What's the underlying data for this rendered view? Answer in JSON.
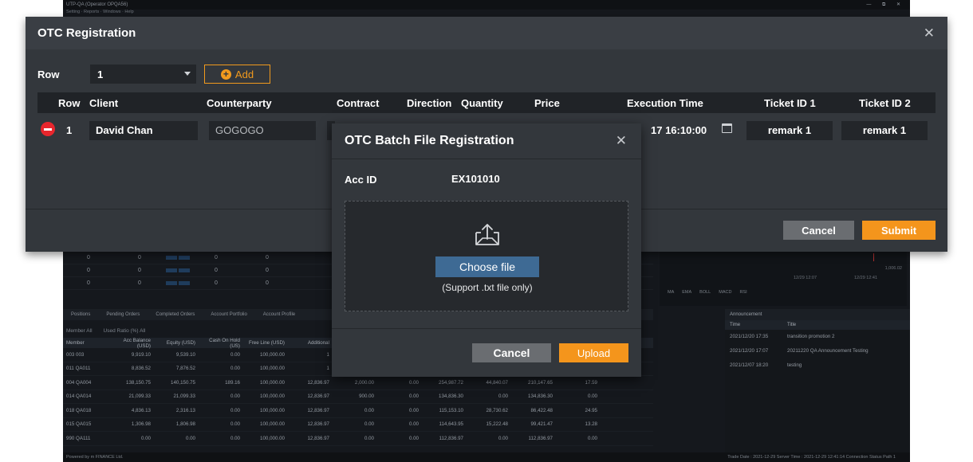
{
  "background": {
    "title": "UTP-QA (Operator OPQA56)",
    "menu": "Setting · Reports · Windows · Help",
    "window_controls": "— ⧉ ✕",
    "tabs": [
      "Positions",
      "Pending Orders",
      "Completed Orders",
      "Account Portfolio",
      "Account Profile"
    ],
    "filter": {
      "member_label": "Member",
      "member_value": "All",
      "ratio_label": "Used Ratio (%)",
      "ratio_value": "All"
    },
    "columns": [
      "Member",
      "Acc Balance (USD)",
      "Equity (USD)",
      "Cash On Hold (US)",
      "Free Line (USD)",
      "Additional"
    ],
    "rows": [
      [
        "003 003",
        "9,919.10",
        "9,539.10",
        "0.00",
        "100,000.00",
        "1"
      ],
      [
        "011 QA011",
        "8,836.52",
        "7,876.52",
        "0.00",
        "100,000.00",
        "1"
      ],
      [
        "004 QA004",
        "138,150.75",
        "140,150.75",
        "189.16",
        "100,000.00",
        "12,836.97",
        "2,000.00",
        "0.00",
        "254,987.72",
        "44,840.07",
        "210,147.65",
        "17.59"
      ],
      [
        "014 QA014",
        "21,099.33",
        "21,099.33",
        "0.00",
        "100,000.00",
        "12,836.97",
        "900.00",
        "0.00",
        "134,836.30",
        "0.00",
        "134,836.30",
        "0.00"
      ],
      [
        "018 QA018",
        "4,836.13",
        "2,316.13",
        "0.00",
        "100,000.00",
        "12,836.97",
        "0.00",
        "0.00",
        "115,153.10",
        "28,730.62",
        "86,422.48",
        "24.95"
      ],
      [
        "015 QA015",
        "1,306.98",
        "1,806.98",
        "0.00",
        "100,000.00",
        "12,836.97",
        "0.00",
        "0.00",
        "114,643.95",
        "15,222.48",
        "99,421.47",
        "13.28"
      ],
      [
        "990 QA111",
        "0.00",
        "0.00",
        "0.00",
        "100,000.00",
        "12,836.97",
        "0.00",
        "0.00",
        "112,836.97",
        "0.00",
        "112,836.97",
        "0.00"
      ]
    ],
    "chart_labels": [
      "1,006.02",
      "12/29 12:07",
      "12/29 12:41"
    ],
    "chart_tabs": [
      "MA",
      "EMA",
      "BOLL",
      "MACD",
      "RSI"
    ],
    "announcement": {
      "tab": "Announcement",
      "columns": [
        "Time",
        "Title"
      ],
      "rows": [
        [
          "2021/12/20 17:35",
          "transition promotion 2"
        ],
        [
          "2021/12/20 17:07",
          "20211220 QA Announcement Testing"
        ],
        [
          "2021/12/07 18:20",
          "testing"
        ]
      ]
    },
    "status_left": "Powered by m FINANCE Ltd.",
    "status_right": "Trade Date : 2021-12-29   Server Time : 2021-12-29 12:41:14   Connection Status   Path 1"
  },
  "otc": {
    "title": "OTC Registration",
    "close_glyph": "✕",
    "row_label": "Row",
    "row_value": "1",
    "add_label": "Add",
    "add_glyph": "+",
    "columns": [
      "Row",
      "Client",
      "Counterparty",
      "Contract",
      "Direction",
      "Quantity",
      "Price",
      "Execution Time",
      "Ticket ID 1",
      "Ticket ID 2"
    ],
    "row": {
      "num": "1",
      "client": "David Chan",
      "counterparty": "GOGOGO",
      "execution_time": "17 16:10:00",
      "ticket1": "remark 1",
      "ticket2": "remark 1"
    },
    "cancel_label": "Cancel",
    "submit_label": "Submit"
  },
  "batch": {
    "title": "OTC Batch File Registration",
    "close_glyph": "✕",
    "acc_label": "Acc ID",
    "acc_value": "EX101010",
    "choose_label": "Choose file",
    "support_text": "(Support .txt file only)",
    "cancel_label": "Cancel",
    "upload_label": "Upload"
  },
  "colors": {
    "accent": "#f4951c",
    "choose": "#3e6a94",
    "danger": "#e8262d",
    "dialog": "#33373c"
  }
}
